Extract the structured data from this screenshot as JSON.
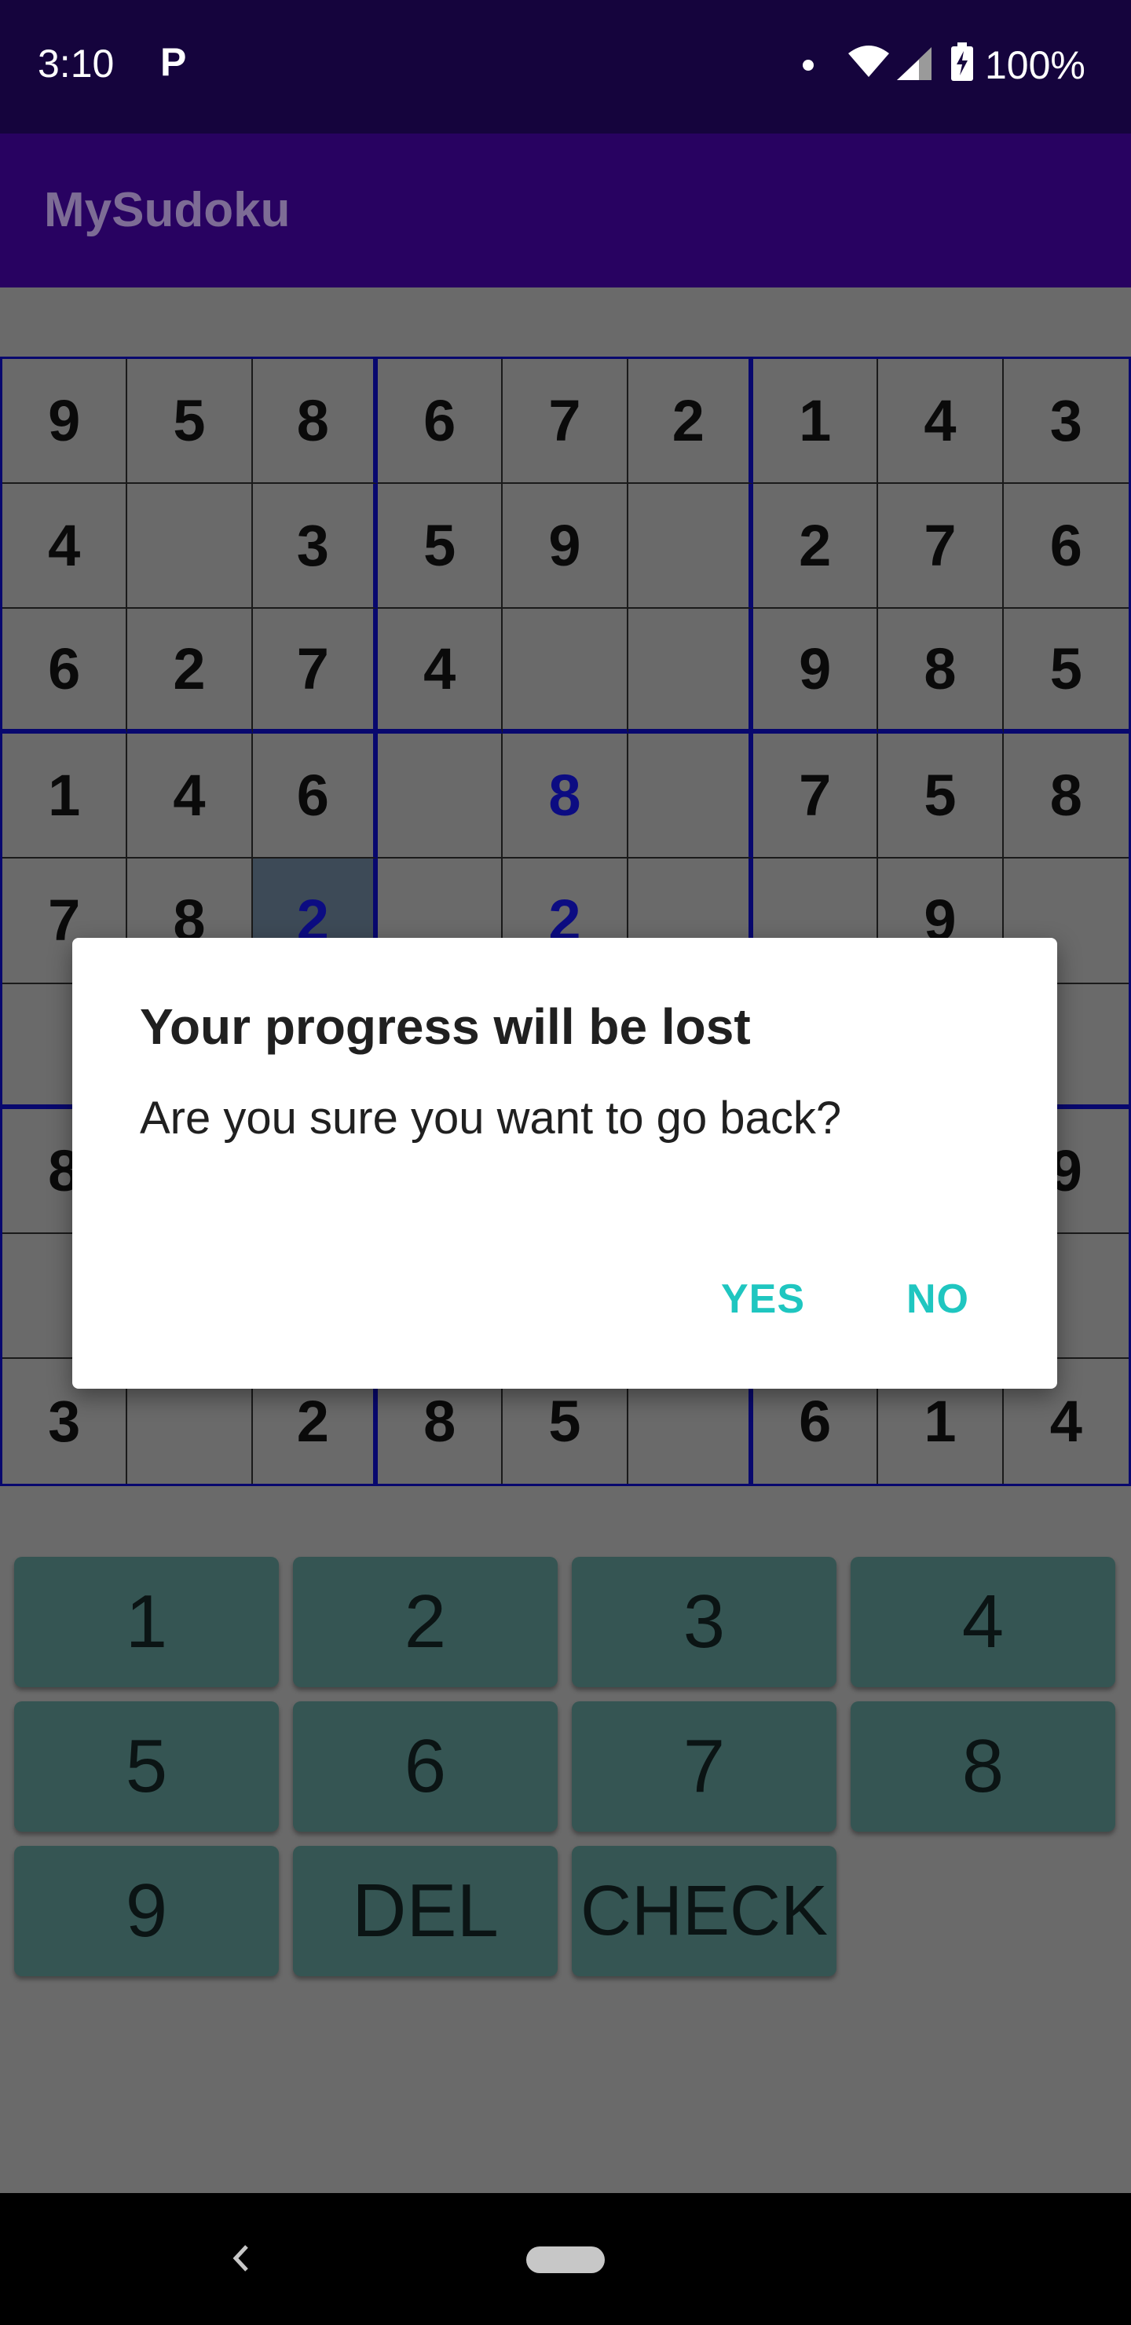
{
  "status_bar": {
    "time": "3:10",
    "notification_icon": "P",
    "battery": "100%"
  },
  "app_bar": {
    "title": "MySudoku"
  },
  "grid": [
    [
      "9",
      "5",
      "8",
      "6",
      "7",
      "2",
      "1",
      "4",
      "3"
    ],
    [
      "4",
      "",
      "3",
      "5",
      "9",
      "",
      "2",
      "7",
      "6"
    ],
    [
      "6",
      "2",
      "7",
      "4",
      "",
      "",
      "9",
      "8",
      "5"
    ],
    [
      "1",
      "4",
      "6",
      "",
      "8",
      "",
      "7",
      "5",
      "8"
    ],
    [
      "7",
      "8",
      "2",
      "",
      "2",
      "",
      "",
      "9",
      ""
    ],
    [
      "",
      "",
      "",
      "",
      "",
      "",
      "",
      "",
      ""
    ],
    [
      "8",
      "",
      "",
      "",
      "",
      "",
      "",
      "",
      "9"
    ],
    [
      "",
      "",
      "",
      "",
      "",
      "",
      "",
      "",
      ""
    ],
    [
      "3",
      "",
      "2",
      "8",
      "5",
      "",
      "6",
      "1",
      "4"
    ]
  ],
  "user_entries": [
    [
      3,
      4
    ],
    [
      4,
      2
    ],
    [
      4,
      4
    ]
  ],
  "selected_cell": [
    4,
    2
  ],
  "keypad": [
    "1",
    "2",
    "3",
    "4",
    "5",
    "6",
    "7",
    "8",
    "9",
    "DEL",
    "CHECK"
  ],
  "dialog": {
    "title": "Your progress will be lost",
    "message": "Are you sure you want to go back?",
    "yes": "YES",
    "no": "NO"
  },
  "colors": {
    "status_bar": "#15043d",
    "app_bar": "#280261",
    "dialog_button": "#1fc6c0",
    "user_entry": "#0c0c82",
    "keypad_button": "#355553"
  }
}
